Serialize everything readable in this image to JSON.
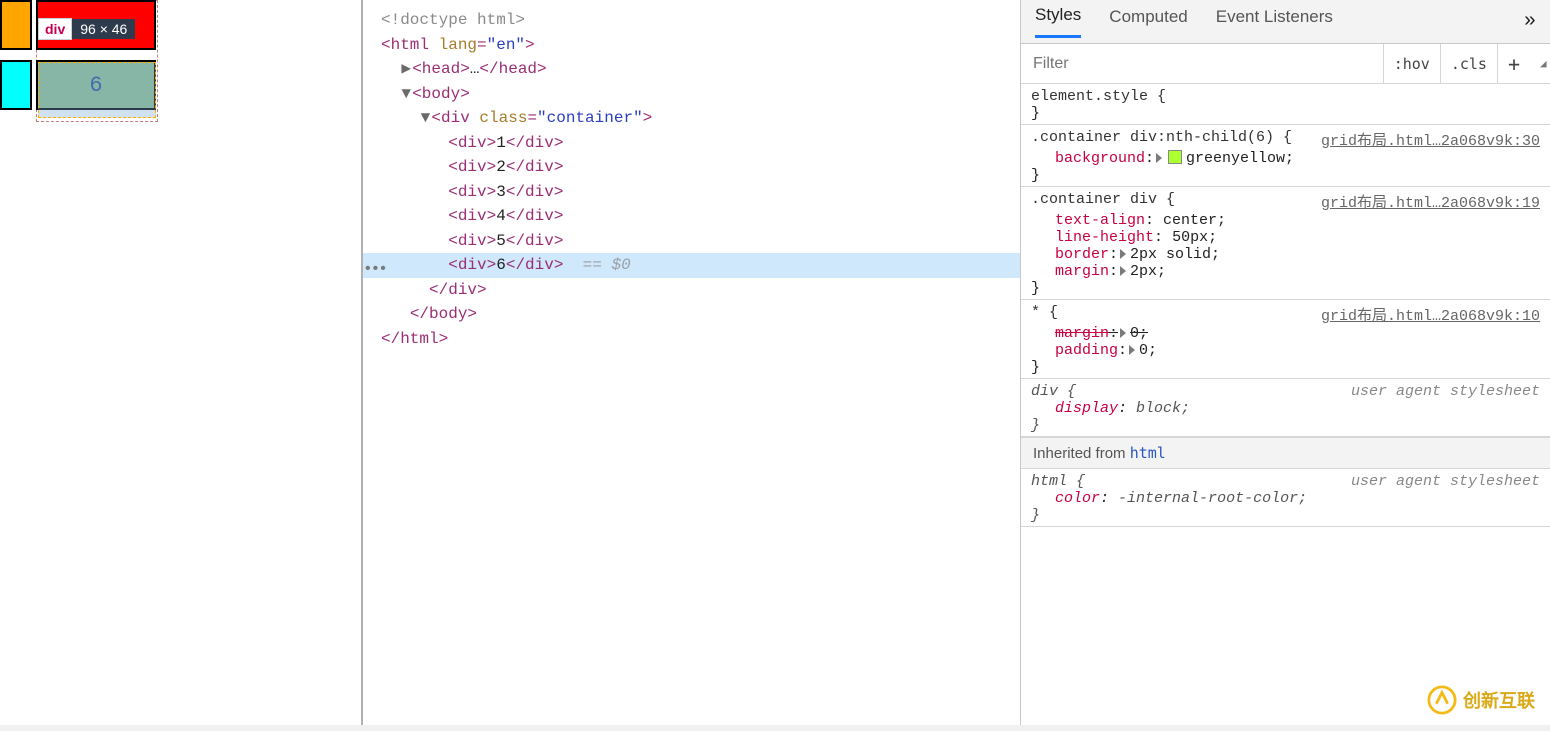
{
  "preview": {
    "tooltip_tag": "div",
    "tooltip_dims": "96 × 46",
    "cell_label": "6"
  },
  "dom": {
    "doctype": "<!doctype html>",
    "html_open": "<html lang=\"en\">",
    "head": "<head>…</head>",
    "body_open": "<body>",
    "container_open": "<div class=\"container\">",
    "children": [
      "1",
      "2",
      "3",
      "4",
      "5",
      "6"
    ],
    "selected_suffix": " == $0",
    "container_close": "</div>",
    "body_close": "</body>",
    "html_close": "</html>"
  },
  "styles": {
    "tabs": [
      "Styles",
      "Computed",
      "Event Listeners"
    ],
    "filter_placeholder": "Filter",
    "toolbuttons": {
      "hov": ":hov",
      "cls": ".cls",
      "plus": "+"
    },
    "rules": [
      {
        "selector": "element.style {",
        "props": [],
        "close": "}"
      },
      {
        "selector": ".container div:nth-child(6) {",
        "source": "grid布局.html…2a068v9k:30",
        "props": [
          {
            "name": "background",
            "tri": true,
            "swatch": "#ADFF2F",
            "value": "greenyellow;"
          }
        ],
        "close": "}"
      },
      {
        "selector": ".container div {",
        "source": "grid布局.html…2a068v9k:19",
        "props": [
          {
            "name": "text-align",
            "value": "center;"
          },
          {
            "name": "line-height",
            "value": "50px;"
          },
          {
            "name": "border",
            "tri": true,
            "value": "2px solid;"
          },
          {
            "name": "margin",
            "tri": true,
            "value": "2px;"
          }
        ],
        "close": "}"
      },
      {
        "selector": "* {",
        "source": "grid布局.html…2a068v9k:10",
        "props": [
          {
            "name": "margin",
            "tri": true,
            "value": "0;",
            "strike": true
          },
          {
            "name": "padding",
            "tri": true,
            "value": "0;"
          }
        ],
        "close": "}"
      },
      {
        "selector": "div {",
        "source_italic": "user agent stylesheet",
        "props": [
          {
            "name": "display",
            "value": "block;",
            "italic": true
          }
        ],
        "close": "}",
        "italic": true
      },
      {
        "separator": "Inherited from ",
        "sep_kw": "html"
      },
      {
        "selector": "html {",
        "source_italic": "user agent stylesheet",
        "props": [
          {
            "name": "color",
            "value": "-internal-root-color;",
            "italic": true
          }
        ],
        "close": "}",
        "italic": true
      }
    ]
  },
  "watermark": "创新互联"
}
